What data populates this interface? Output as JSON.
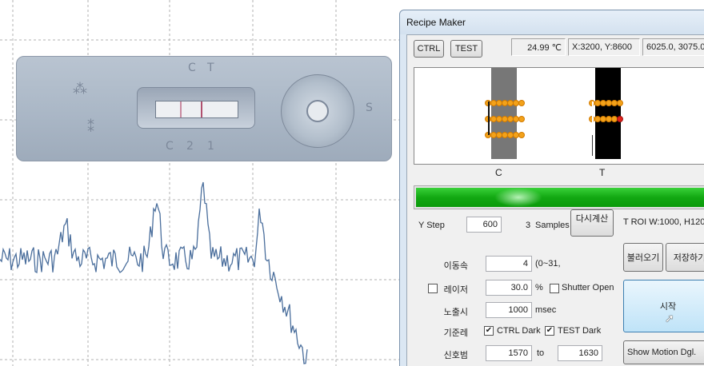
{
  "window": {
    "title": "Recipe Maker"
  },
  "toolbar": {
    "ctrl_label": "CTRL",
    "test_label": "TEST"
  },
  "status": {
    "temperature": "24.99 ℃",
    "position": "X:3200, Y:8600",
    "coords": "6025.0, 3075.0"
  },
  "preview": {
    "label_c": "C",
    "label_t": "T"
  },
  "progress": {
    "value": 0.99,
    "color": "#12a812"
  },
  "ystep": {
    "label": "Y Step",
    "value": "600",
    "samples_value": "3",
    "samples_label": "Samples",
    "recalc_label": "다시계산"
  },
  "roi": {
    "text": "T ROI W:1000, H120"
  },
  "actions": {
    "load_label": "불러오기",
    "save_label": "저장하기",
    "start_label": "시작",
    "motion_label": "Show Motion Dgl."
  },
  "form": {
    "speed": {
      "label": "이동속",
      "value": "4",
      "hint": "(0~31,"
    },
    "laser": {
      "label": "레이저",
      "value": "30.0",
      "unit": "%",
      "checked": false
    },
    "shutter": {
      "label": "Shutter Open",
      "checked": false
    },
    "exposure": {
      "label": "노출시",
      "value": "1000",
      "unit": "msec"
    },
    "reference": {
      "label": "기준레",
      "ctrl_dark": "CTRL Dark",
      "test_dark": "TEST Dark",
      "ctrl_checked": true,
      "test_checked": true
    },
    "signal": {
      "label": "신호범",
      "from": "1570",
      "to_label": "to",
      "to": "1630"
    }
  },
  "strip": {
    "marks": [
      "C",
      "T",
      "C",
      "2",
      "1",
      "S"
    ]
  },
  "colors": {
    "plot_line": "#4a6e9c",
    "grid": "#b0b0b0",
    "ctrl_band": "#777777",
    "test_band": "#000000",
    "dot": "#f3a21a",
    "accent_dot": "#e0241b"
  }
}
